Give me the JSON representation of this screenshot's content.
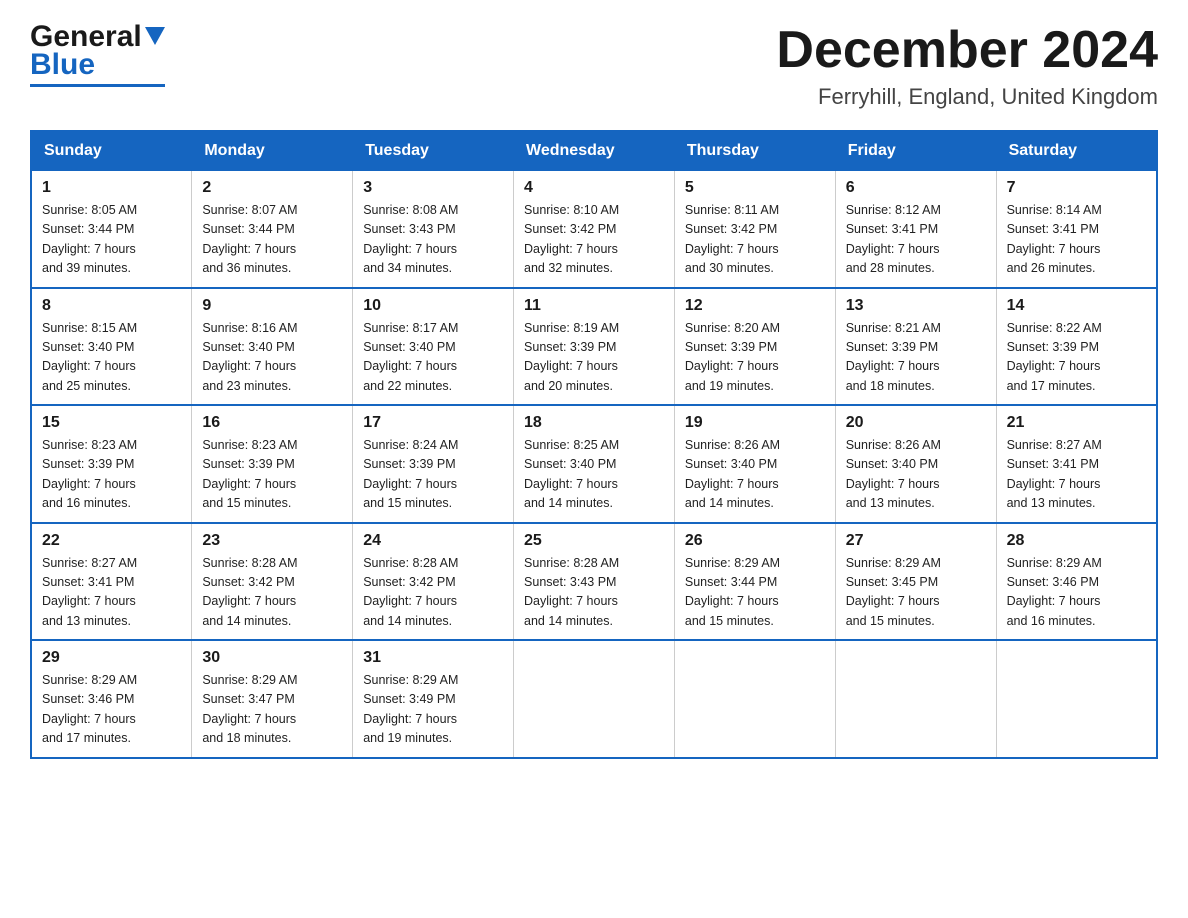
{
  "header": {
    "logo_general": "General",
    "logo_blue": "Blue",
    "month_title": "December 2024",
    "location": "Ferryhill, England, United Kingdom"
  },
  "weekdays": [
    "Sunday",
    "Monday",
    "Tuesday",
    "Wednesday",
    "Thursday",
    "Friday",
    "Saturday"
  ],
  "weeks": [
    [
      {
        "day": "1",
        "sunrise": "8:05 AM",
        "sunset": "3:44 PM",
        "daylight": "7 hours and 39 minutes."
      },
      {
        "day": "2",
        "sunrise": "8:07 AM",
        "sunset": "3:44 PM",
        "daylight": "7 hours and 36 minutes."
      },
      {
        "day": "3",
        "sunrise": "8:08 AM",
        "sunset": "3:43 PM",
        "daylight": "7 hours and 34 minutes."
      },
      {
        "day": "4",
        "sunrise": "8:10 AM",
        "sunset": "3:42 PM",
        "daylight": "7 hours and 32 minutes."
      },
      {
        "day": "5",
        "sunrise": "8:11 AM",
        "sunset": "3:42 PM",
        "daylight": "7 hours and 30 minutes."
      },
      {
        "day": "6",
        "sunrise": "8:12 AM",
        "sunset": "3:41 PM",
        "daylight": "7 hours and 28 minutes."
      },
      {
        "day": "7",
        "sunrise": "8:14 AM",
        "sunset": "3:41 PM",
        "daylight": "7 hours and 26 minutes."
      }
    ],
    [
      {
        "day": "8",
        "sunrise": "8:15 AM",
        "sunset": "3:40 PM",
        "daylight": "7 hours and 25 minutes."
      },
      {
        "day": "9",
        "sunrise": "8:16 AM",
        "sunset": "3:40 PM",
        "daylight": "7 hours and 23 minutes."
      },
      {
        "day": "10",
        "sunrise": "8:17 AM",
        "sunset": "3:40 PM",
        "daylight": "7 hours and 22 minutes."
      },
      {
        "day": "11",
        "sunrise": "8:19 AM",
        "sunset": "3:39 PM",
        "daylight": "7 hours and 20 minutes."
      },
      {
        "day": "12",
        "sunrise": "8:20 AM",
        "sunset": "3:39 PM",
        "daylight": "7 hours and 19 minutes."
      },
      {
        "day": "13",
        "sunrise": "8:21 AM",
        "sunset": "3:39 PM",
        "daylight": "7 hours and 18 minutes."
      },
      {
        "day": "14",
        "sunrise": "8:22 AM",
        "sunset": "3:39 PM",
        "daylight": "7 hours and 17 minutes."
      }
    ],
    [
      {
        "day": "15",
        "sunrise": "8:23 AM",
        "sunset": "3:39 PM",
        "daylight": "7 hours and 16 minutes."
      },
      {
        "day": "16",
        "sunrise": "8:23 AM",
        "sunset": "3:39 PM",
        "daylight": "7 hours and 15 minutes."
      },
      {
        "day": "17",
        "sunrise": "8:24 AM",
        "sunset": "3:39 PM",
        "daylight": "7 hours and 15 minutes."
      },
      {
        "day": "18",
        "sunrise": "8:25 AM",
        "sunset": "3:40 PM",
        "daylight": "7 hours and 14 minutes."
      },
      {
        "day": "19",
        "sunrise": "8:26 AM",
        "sunset": "3:40 PM",
        "daylight": "7 hours and 14 minutes."
      },
      {
        "day": "20",
        "sunrise": "8:26 AM",
        "sunset": "3:40 PM",
        "daylight": "7 hours and 13 minutes."
      },
      {
        "day": "21",
        "sunrise": "8:27 AM",
        "sunset": "3:41 PM",
        "daylight": "7 hours and 13 minutes."
      }
    ],
    [
      {
        "day": "22",
        "sunrise": "8:27 AM",
        "sunset": "3:41 PM",
        "daylight": "7 hours and 13 minutes."
      },
      {
        "day": "23",
        "sunrise": "8:28 AM",
        "sunset": "3:42 PM",
        "daylight": "7 hours and 14 minutes."
      },
      {
        "day": "24",
        "sunrise": "8:28 AM",
        "sunset": "3:42 PM",
        "daylight": "7 hours and 14 minutes."
      },
      {
        "day": "25",
        "sunrise": "8:28 AM",
        "sunset": "3:43 PM",
        "daylight": "7 hours and 14 minutes."
      },
      {
        "day": "26",
        "sunrise": "8:29 AM",
        "sunset": "3:44 PM",
        "daylight": "7 hours and 15 minutes."
      },
      {
        "day": "27",
        "sunrise": "8:29 AM",
        "sunset": "3:45 PM",
        "daylight": "7 hours and 15 minutes."
      },
      {
        "day": "28",
        "sunrise": "8:29 AM",
        "sunset": "3:46 PM",
        "daylight": "7 hours and 16 minutes."
      }
    ],
    [
      {
        "day": "29",
        "sunrise": "8:29 AM",
        "sunset": "3:46 PM",
        "daylight": "7 hours and 17 minutes."
      },
      {
        "day": "30",
        "sunrise": "8:29 AM",
        "sunset": "3:47 PM",
        "daylight": "7 hours and 18 minutes."
      },
      {
        "day": "31",
        "sunrise": "8:29 AM",
        "sunset": "3:49 PM",
        "daylight": "7 hours and 19 minutes."
      },
      null,
      null,
      null,
      null
    ]
  ],
  "labels": {
    "sunrise": "Sunrise:",
    "sunset": "Sunset:",
    "daylight": "Daylight:"
  }
}
